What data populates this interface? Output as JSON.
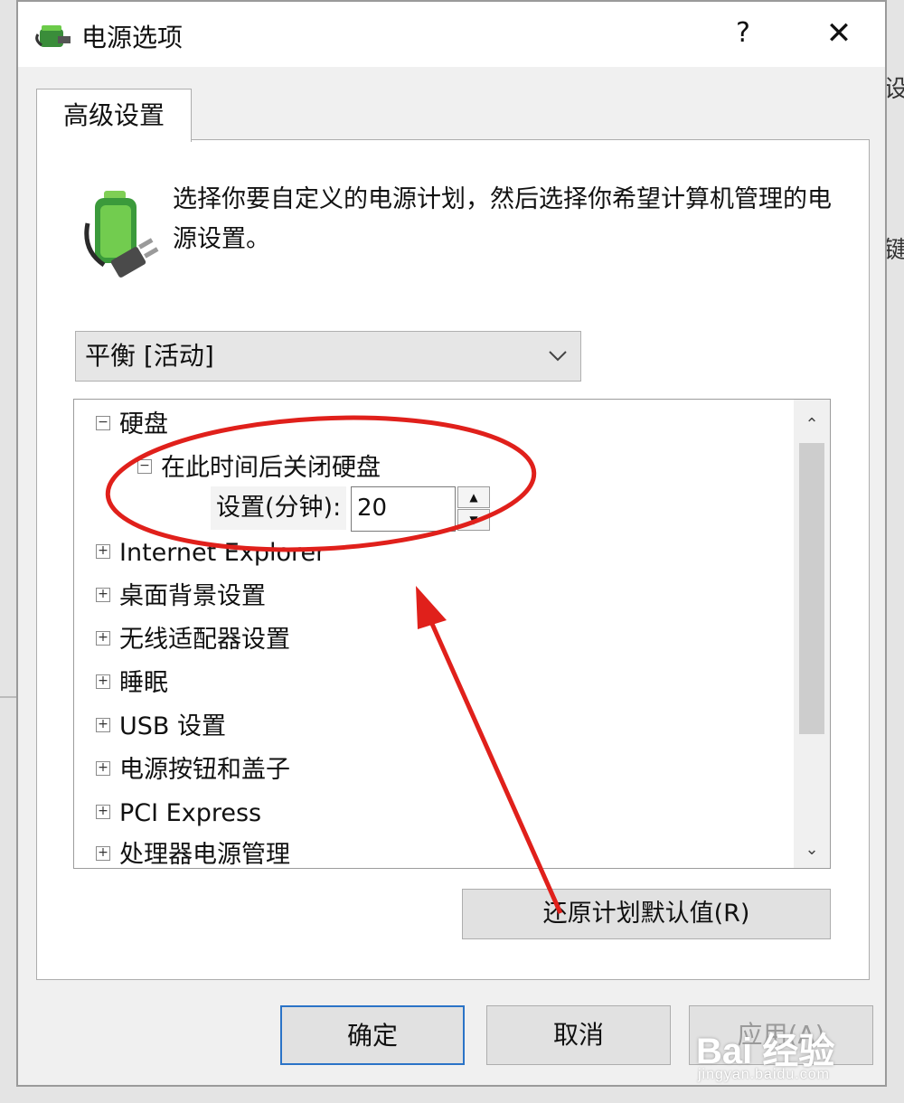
{
  "window": {
    "title": "电源选项",
    "help_label": "?",
    "close_label": "✕"
  },
  "tabs": [
    {
      "label": "高级设置"
    }
  ],
  "description": "选择你要自定义的电源计划，然后选择你希望计算机管理的电源设置。",
  "plan_select": {
    "value": "平衡 [活动]"
  },
  "tree": {
    "items": [
      {
        "label": "硬盘",
        "toggle": "−"
      },
      {
        "label": "在此时间后关闭硬盘",
        "toggle": "−"
      },
      {
        "label": "Internet Explorer",
        "toggle": "+"
      },
      {
        "label": "桌面背景设置",
        "toggle": "+"
      },
      {
        "label": "无线适配器设置",
        "toggle": "+"
      },
      {
        "label": "睡眠",
        "toggle": "+"
      },
      {
        "label": "USB 设置",
        "toggle": "+"
      },
      {
        "label": "电源按钮和盖子",
        "toggle": "+"
      },
      {
        "label": "PCI Express",
        "toggle": "+"
      },
      {
        "label": "处理器电源管理",
        "toggle": "+"
      }
    ],
    "setting_label": "设置(分钟):",
    "setting_value": "20"
  },
  "buttons": {
    "restore": "还原计划默认值(R)",
    "ok": "确定",
    "cancel": "取消",
    "apply": "应用(A)"
  },
  "watermark": {
    "main": "Bai 经验",
    "sub": "jingyan.baidu.com"
  },
  "colors": {
    "annotation": "#e0201b",
    "focus_border": "#2a73c7"
  }
}
